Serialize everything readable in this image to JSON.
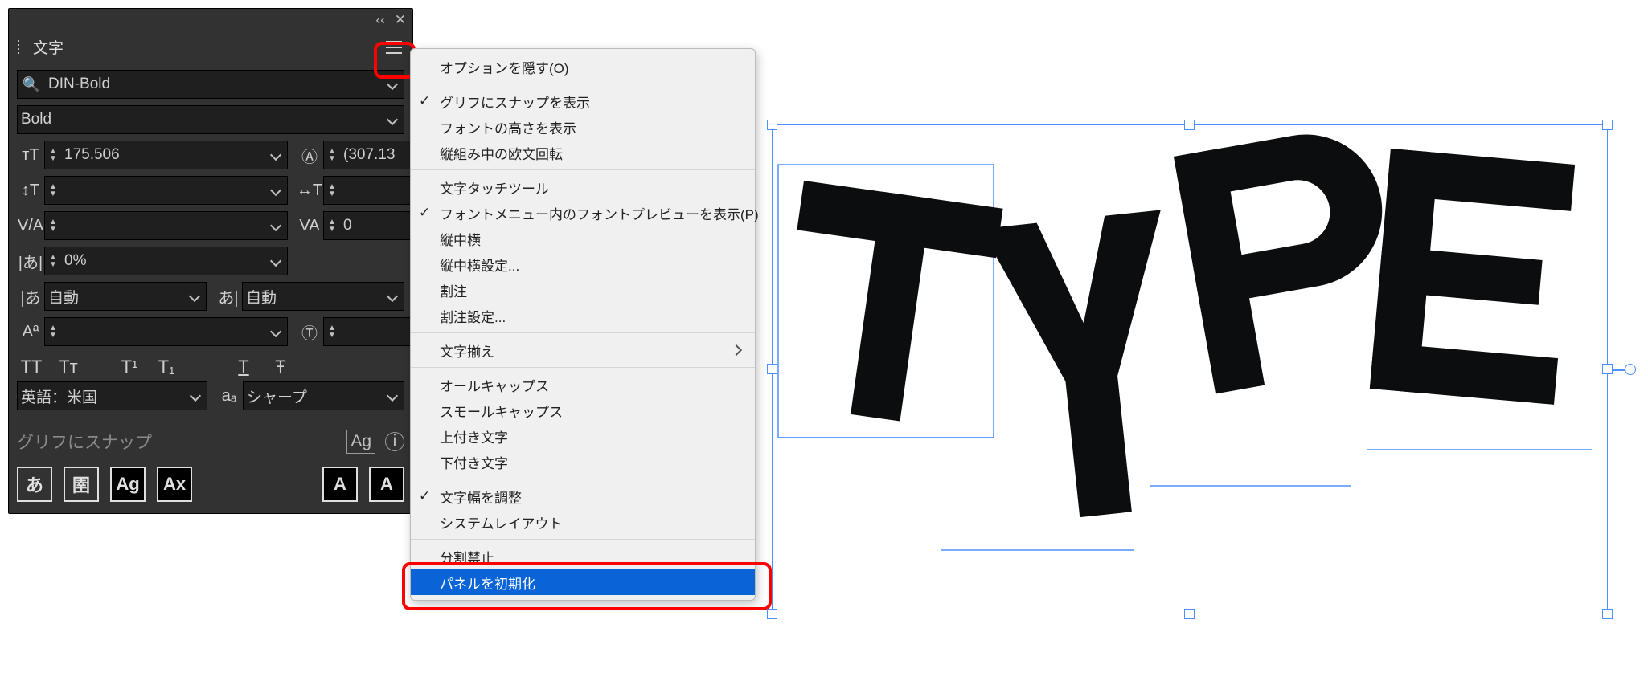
{
  "panel": {
    "title": "文字",
    "font_family": "DIN-Bold",
    "font_style": "Bold",
    "font_size": "175.506",
    "leading": "(307.13",
    "vscale": "",
    "hscale": "",
    "kerning": "",
    "tracking": "0",
    "tsume": "0%",
    "aki_left": "自動",
    "aki_right": "自動",
    "baseline_shift": "",
    "char_rotation": "",
    "language": "英語：米国",
    "antialiasing": "シャープ",
    "snap_label": "グリフにスナップ",
    "caps_buttons": [
      "TT",
      "Tᴛ",
      "T¹",
      "T₁",
      "T",
      "Ŧ"
    ],
    "glyph_buttons_left": [
      "あ",
      "圉",
      "Ag",
      "Ax"
    ],
    "glyph_buttons_right": [
      "A",
      "A"
    ]
  },
  "menu": {
    "items": [
      {
        "key": "hide_options",
        "label": "オプションを隠す(O)",
        "type": "item"
      },
      {
        "type": "sep"
      },
      {
        "key": "snap_glyph",
        "label": "グリフにスナップを表示",
        "type": "item",
        "checked": true
      },
      {
        "key": "font_height",
        "label": "フォントの高さを表示",
        "type": "item"
      },
      {
        "key": "tcy_rotate",
        "label": "縦組み中の欧文回転",
        "type": "item"
      },
      {
        "type": "sep"
      },
      {
        "key": "touch_tool",
        "label": "文字タッチツール",
        "type": "item"
      },
      {
        "key": "font_preview",
        "label": "フォントメニュー内のフォントプレビューを表示(P)",
        "type": "item",
        "checked": true
      },
      {
        "key": "tcy",
        "label": "縦中横",
        "type": "item"
      },
      {
        "key": "tcy_settings",
        "label": "縦中横設定...",
        "type": "item"
      },
      {
        "key": "warichu",
        "label": "割注",
        "type": "item"
      },
      {
        "key": "warichu_settings",
        "label": "割注設定...",
        "type": "item"
      },
      {
        "type": "sep"
      },
      {
        "key": "mojisoroe",
        "label": "文字揃え",
        "type": "item",
        "submenu": true
      },
      {
        "type": "sep"
      },
      {
        "key": "allcaps",
        "label": "オールキャップス",
        "type": "item"
      },
      {
        "key": "smallcaps",
        "label": "スモールキャップス",
        "type": "item"
      },
      {
        "key": "superscript",
        "label": "上付き文字",
        "type": "item"
      },
      {
        "key": "subscript",
        "label": "下付き文字",
        "type": "item"
      },
      {
        "type": "sep"
      },
      {
        "key": "adjust_width",
        "label": "文字幅を調整",
        "type": "item",
        "checked": true
      },
      {
        "key": "system_layout",
        "label": "システムレイアウト",
        "type": "item"
      },
      {
        "type": "sep"
      },
      {
        "key": "no_break",
        "label": "分割禁止",
        "type": "item"
      },
      {
        "key": "reset_panel",
        "label": "パネルを初期化",
        "type": "item",
        "selected": true
      }
    ]
  },
  "canvas": {
    "text": "TYPE"
  }
}
